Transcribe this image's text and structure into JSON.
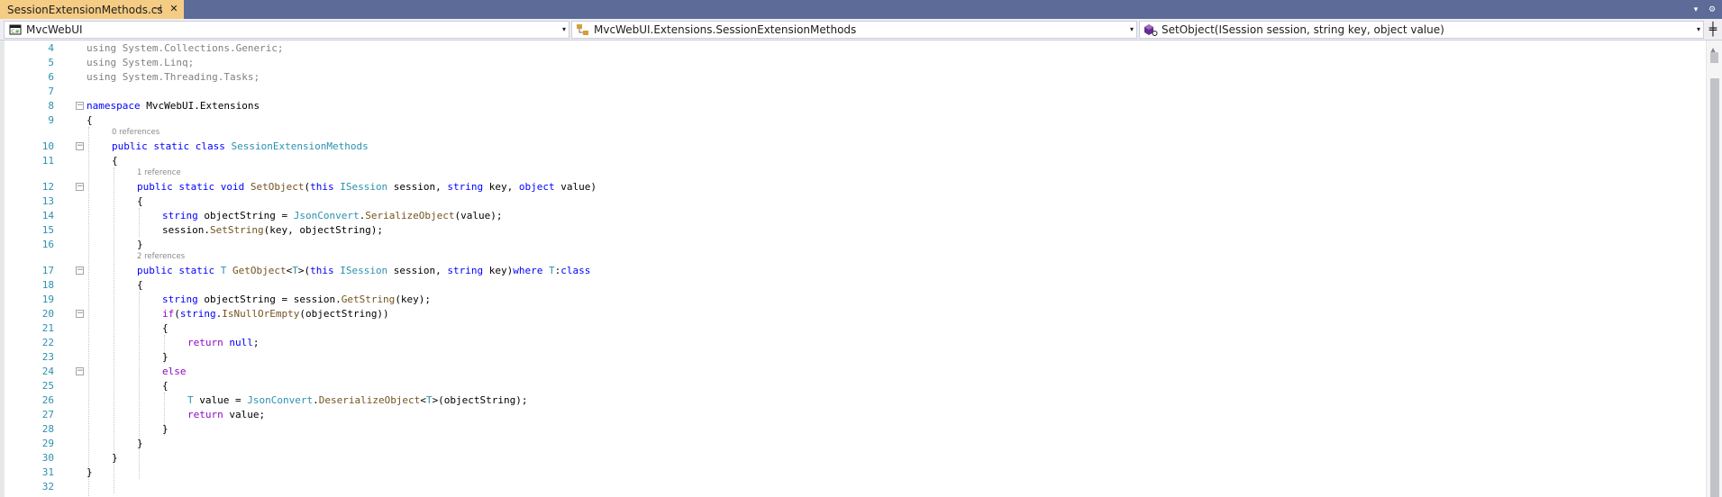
{
  "tab": {
    "title": "SessionExtensionMethods.cs",
    "pin_glyph": "⊣",
    "close_glyph": "✕"
  },
  "strip": {
    "dropdown_glyph": "▾",
    "settings_glyph": "⚙"
  },
  "navbar": {
    "project": "MvcWebUI",
    "type": "MvcWebUI.Extensions.SessionExtensionMethods",
    "member": "SetObject(ISession session, string key, object value)",
    "arrow_glyph": "▾",
    "split_glyph": "╪"
  },
  "colors": {
    "keyword": "#0000ff",
    "control_keyword": "#8f08c4",
    "type": "#2b91af",
    "method": "#74531f",
    "line_number": "#2b91af",
    "tab_active": "#f5cc84",
    "tab_strip": "#5d6b99"
  },
  "editor": {
    "line_numbers": [
      "4",
      "5",
      "6",
      "7",
      "8",
      "9",
      "10",
      "11",
      "12",
      "13",
      "14",
      "15",
      "16",
      "17",
      "18",
      "19",
      "20",
      "21",
      "22",
      "23",
      "24",
      "25",
      "26",
      "27",
      "28",
      "29",
      "30",
      "31",
      "32"
    ],
    "lens": {
      "class_refs": "0 references",
      "setobject_refs": "1 reference",
      "getobject_refs": "2 references"
    },
    "code": {
      "l4": [
        "using",
        " System.Collections.Generic;"
      ],
      "l5": [
        "using",
        " System.Linq;"
      ],
      "l6": [
        "using",
        " System.Threading.Tasks;"
      ],
      "l8": [
        "namespace",
        " MvcWebUI.Extensions"
      ],
      "l9": "{",
      "l10": [
        "public static class",
        " ",
        "SessionExtensionMethods"
      ],
      "l11": "{",
      "l12": [
        "public static void",
        " ",
        "SetObject",
        "(",
        "this",
        " ",
        "ISession",
        " session, ",
        "string",
        " key, ",
        "object",
        " value)"
      ],
      "l13": "{",
      "l14": [
        "string",
        " objectString = ",
        "JsonConvert",
        ".",
        "SerializeObject",
        "(value);"
      ],
      "l15": [
        "session.",
        "SetString",
        "(key, objectString);"
      ],
      "l16": "}",
      "l17": [
        "public static",
        " ",
        "T",
        " ",
        "GetObject",
        "<",
        "T",
        ">(",
        "this",
        " ",
        "ISession",
        " session, ",
        "string",
        " key)",
        "where",
        " ",
        "T",
        ":",
        "class"
      ],
      "l18": "{",
      "l19": [
        "string",
        " objectString = session.",
        "GetString",
        "(key);"
      ],
      "l20": [
        "if",
        "(",
        "string",
        ".",
        "IsNullOrEmpty",
        "(objectString))"
      ],
      "l21": "{",
      "l22": [
        "return",
        " ",
        "null",
        ";"
      ],
      "l23": "}",
      "l24": "else",
      "l25": "{",
      "l26": [
        "T",
        " value = ",
        "JsonConvert",
        ".",
        "DeserializeObject",
        "<",
        "T",
        ">(objectString);"
      ],
      "l27": [
        "return",
        " value;"
      ],
      "l28": "}",
      "l29": "}",
      "l30": "}",
      "l31": "}"
    },
    "fold_glyph": "−"
  }
}
